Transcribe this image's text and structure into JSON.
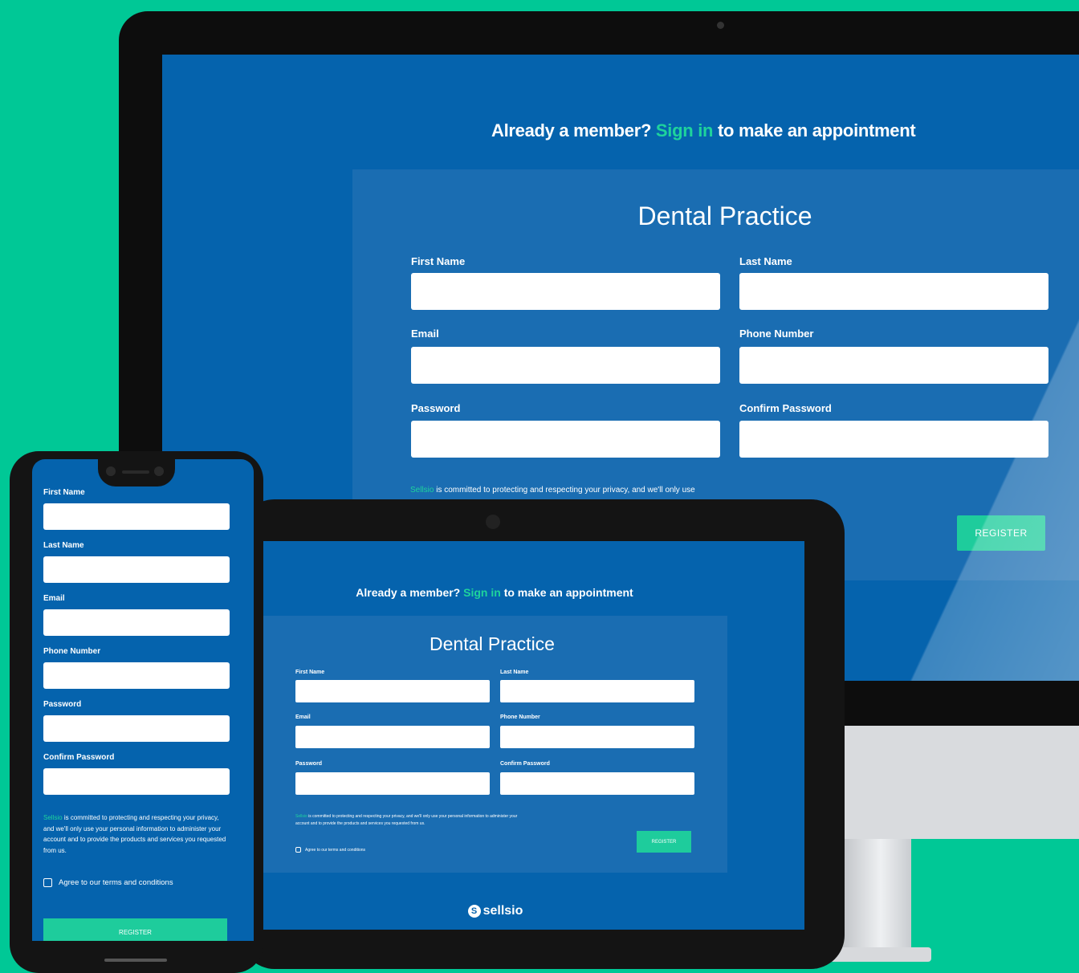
{
  "colors": {
    "background": "#00c896",
    "screen": "#0563ad",
    "card": "#1a6db2",
    "accent": "#1ed39c",
    "button": "#1ecc9c"
  },
  "desktop": {
    "header": {
      "prefix": "Already a member?",
      "link": "Sign in",
      "suffix": "to make an appointment"
    },
    "title": "Dental Practice",
    "labels": {
      "first_name": "First Name",
      "last_name": "Last Name",
      "email": "Email",
      "phone": "Phone Number",
      "password": "Password",
      "confirm_password": "Confirm Password"
    },
    "privacy": {
      "brand": "Sellsio",
      "text": "is committed to protecting and respecting your privacy, and we'll only use"
    },
    "register": "REGISTER"
  },
  "tablet": {
    "header": {
      "prefix": "Already a member?",
      "link": "Sign in",
      "suffix": "to make an appointment"
    },
    "title": "Dental Practice",
    "labels": {
      "first_name": "First Name",
      "last_name": "Last Name",
      "email": "Email",
      "phone": "Phone Number",
      "password": "Password",
      "confirm_password": "Confirm Password"
    },
    "privacy": {
      "brand": "Sellsio",
      "text": "is committed to protecting and respecting your privacy, and we'll only use your personal information to administer your account and to provide the products and services you requested from us."
    },
    "terms": "Agree to our terms and conditions",
    "register": "REGISTER",
    "logo": "sellsio",
    "logo_glyph": "S"
  },
  "phone": {
    "labels": {
      "first_name": "First Name",
      "last_name": "Last Name",
      "email": "Email",
      "phone": "Phone Number",
      "password": "Password",
      "confirm_password": "Confirm Password"
    },
    "privacy": {
      "brand": "Sellsio",
      "text": "is committed to protecting and respecting your privacy, and we'll only use your personal information to administer your account and to provide the products and services you requested from us."
    },
    "terms": "Agree to our terms and conditions",
    "register": "REGISTER"
  }
}
